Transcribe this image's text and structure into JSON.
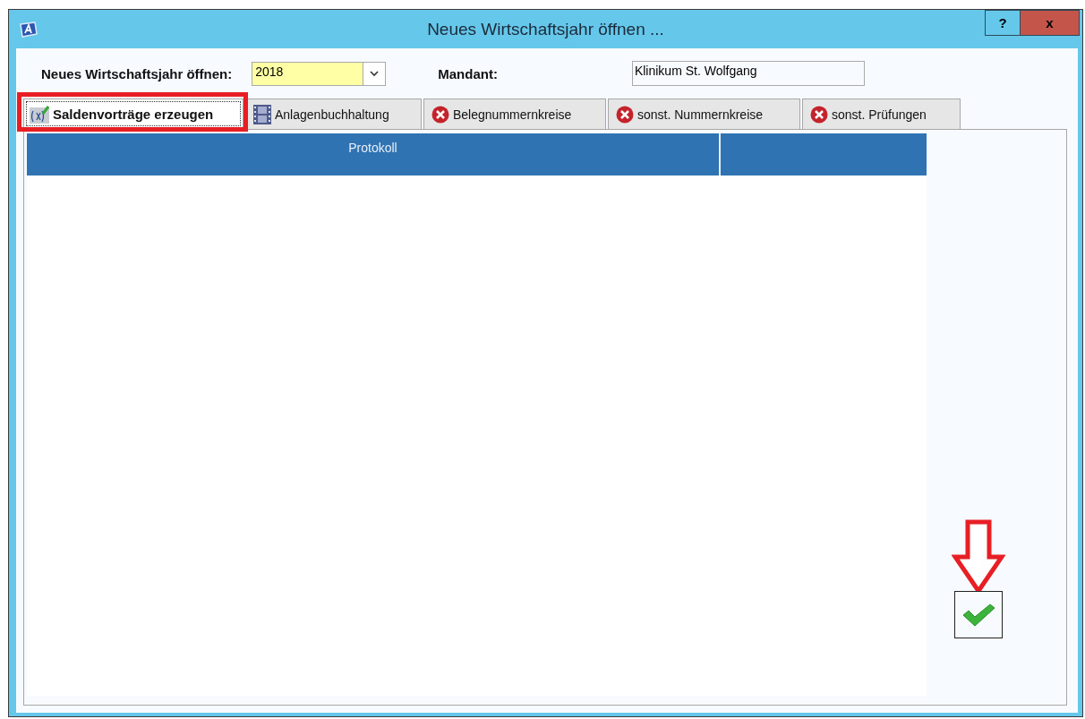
{
  "window": {
    "title": "Neues Wirtschaftsjahr öffnen ...",
    "buttons": [
      {
        "kind": "help",
        "label": "?"
      },
      {
        "kind": "close",
        "label": "x"
      }
    ]
  },
  "year": {
    "label": "Neues Wirtschaftsjahr öffnen:",
    "value": "2018"
  },
  "client": {
    "label": "Mandant:",
    "value": "Klinikum St. Wolfgang"
  },
  "tabs": [
    {
      "label": "Saldenvorträge erzeugen",
      "selected": true,
      "kind": "formula"
    },
    {
      "label": "Anlagenbuchhaltung",
      "selected": false,
      "kind": "film"
    },
    {
      "label": "Belegnummernkreise",
      "selected": false,
      "kind": "error"
    },
    {
      "label": "sonst. Nummernkreise",
      "selected": false,
      "kind": "error"
    },
    {
      "label": "sonst. Prüfungen",
      "selected": false,
      "kind": "error"
    }
  ],
  "table": {
    "columns": [
      "Protokoll"
    ]
  }
}
